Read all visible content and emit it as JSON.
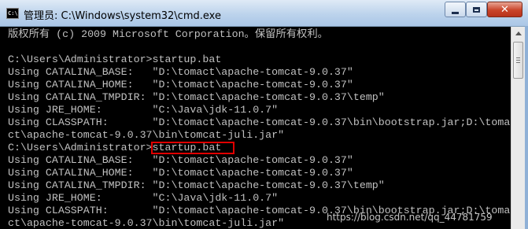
{
  "window": {
    "title": "管理员: C:\\Windows\\system32\\cmd.exe",
    "icon_text": "C:\\",
    "controls": {
      "minimize": "minimize",
      "maximize": "maximize",
      "close": "✕"
    }
  },
  "console": {
    "lines": [
      "版权所有 (c) 2009 Microsoft Corporation。保留所有权利。",
      "",
      "C:\\Users\\Administrator>startup.bat",
      "Using CATALINA_BASE:   \"D:\\tomact\\apache-tomcat-9.0.37\"",
      "Using CATALINA_HOME:   \"D:\\tomact\\apache-tomcat-9.0.37\"",
      "Using CATALINA_TMPDIR: \"D:\\tomact\\apache-tomcat-9.0.37\\temp\"",
      "Using JRE_HOME:        \"C:\\Java\\jdk-11.0.7\"",
      "Using CLASSPATH:       \"D:\\tomact\\apache-tomcat-9.0.37\\bin\\bootstrap.jar;D:\\toma",
      "ct\\apache-tomcat-9.0.37\\bin\\tomcat-juli.jar\"",
      "C:\\Users\\Administrator>startup.bat",
      "Using CATALINA_BASE:   \"D:\\tomact\\apache-tomcat-9.0.37\"",
      "Using CATALINA_HOME:   \"D:\\tomact\\apache-tomcat-9.0.37\"",
      "Using CATALINA_TMPDIR: \"D:\\tomact\\apache-tomcat-9.0.37\\temp\"",
      "Using JRE_HOME:        \"C:\\Java\\jdk-11.0.7\"",
      "Using CLASSPATH:       \"D:\\tomact\\apache-tomcat-9.0.37\\bin\\bootstrap.jar;D:\\toma",
      "ct\\apache-tomcat-9.0.37\\bin\\tomcat-juli.jar\""
    ]
  },
  "watermark": "https://blog.csdn.net/qq_44781759",
  "colors": {
    "console_bg": "#000000",
    "console_fg": "#c0c0c0",
    "highlight": "#e00000"
  }
}
